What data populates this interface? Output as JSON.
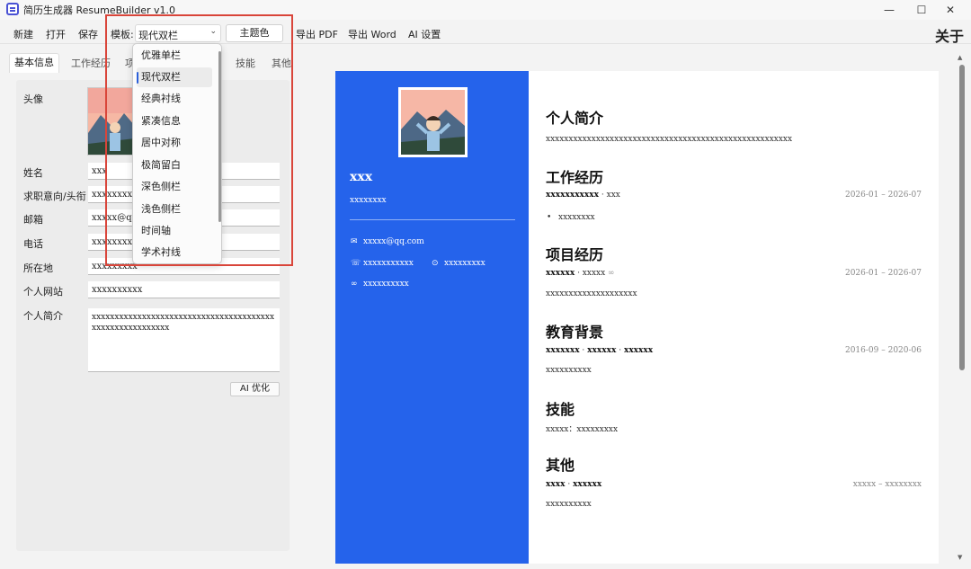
{
  "app": {
    "title": "简历生成器 ResumeBuilder  v1.0"
  },
  "window": {
    "minimize": "—",
    "maximize": "☐",
    "close": "✕"
  },
  "menu": {
    "new": "新建",
    "open": "打开",
    "save": "保存",
    "template_label": "模板:",
    "template_value": "现代双栏",
    "theme": "主题色",
    "export_pdf": "导出 PDF",
    "export_word": "导出 Word",
    "ai_settings": "AI 设置",
    "about": "关于"
  },
  "tabs": [
    "基本信息",
    "工作经历",
    "项",
    "技能",
    "其他"
  ],
  "form": {
    "avatar_label": "头像",
    "name_label": "姓名",
    "name_value": "xxx",
    "title_label": "求职意向/头衔",
    "title_value": "xxxxxxxx",
    "email_label": "邮箱",
    "email_value": "xxxxx@qq",
    "phone_label": "电话",
    "phone_value": "xxxxxxxxx",
    "location_label": "所在地",
    "location_value": "xxxxxxxxx",
    "site_label": "个人网站",
    "site_value": "xxxxxxxxxx",
    "summary_label": "个人简介",
    "summary_value": "xxxxxxxxxxxxxxxxxxxxxxxxxxxxxxxxxxxxxxxxxxxxxxxxxxxxxxxxx",
    "ai_button": "AI 优化"
  },
  "dropdown": {
    "options": [
      "优雅单栏",
      "现代双栏",
      "经典衬线",
      "紧凑信息",
      "居中对称",
      "极简留白",
      "深色侧栏",
      "浅色侧栏",
      "时间轴",
      "学术衬线"
    ],
    "selected_index": 1
  },
  "resume": {
    "name": "xxx",
    "title": "xxxxxxxx",
    "email": "xxxxx@qq.com",
    "phone": "xxxxxxxxxxx",
    "location": "xxxxxxxxx",
    "website": "xxxxxxxxxx",
    "sections": {
      "summary": {
        "heading": "个人简介",
        "text": "xxxxxxxxxxxxxxxxxxxxxxxxxxxxxxxxxxxxxxxxxxxxxxxxxxxxxx"
      },
      "work": {
        "heading": "工作经历",
        "org": "xxxxxxxxxxx",
        "sep": " · ",
        "role": "xxx",
        "date": "2026-01 – 2026-07",
        "bullet": "xxxxxxxx"
      },
      "project": {
        "heading": "项目经历",
        "name": "xxxxxx",
        "sep": " · ",
        "role": "xxxxx",
        "date": "2026-01 – 2026-07",
        "desc": "xxxxxxxxxxxxxxxxxxxx"
      },
      "education": {
        "heading": "教育背景",
        "school": "xxxxxxx",
        "sep": " · ",
        "major": "xxxxxx",
        "sep2": " · ",
        "degree": "xxxxxx",
        "date": "2016-09 – 2020-06",
        "desc": "xxxxxxxxxx"
      },
      "skills": {
        "heading": "技能",
        "line": "xxxxx：xxxxxxxxx"
      },
      "other": {
        "heading": "其他",
        "title": "xxxx",
        "sep": " · ",
        "sub": "xxxxxx",
        "date": "xxxxx – xxxxxxxx",
        "desc": "xxxxxxxxxx"
      }
    }
  },
  "colors": {
    "sidebar": "#2563eb",
    "highlight": "#d9453a"
  }
}
